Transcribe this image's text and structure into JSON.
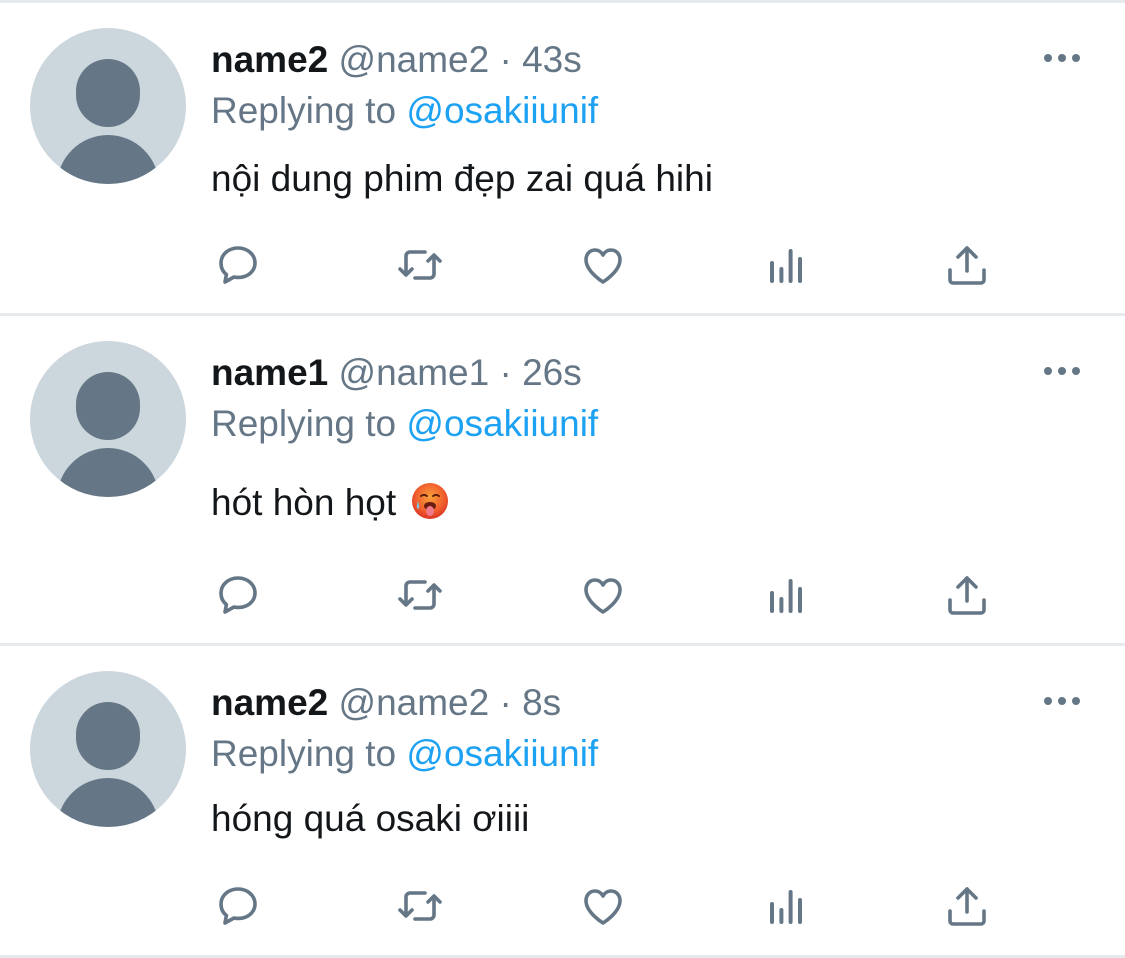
{
  "tweets": [
    {
      "display_name": "name2",
      "handle": "@name2",
      "separator": "·",
      "time": "43s",
      "replying_prefix": "Replying to",
      "replying_handle": "@osakiiunif",
      "text": "nội dung phim đẹp zai quá hihi"
    },
    {
      "display_name": "name1",
      "handle": "@name1",
      "separator": "·",
      "time": "26s",
      "replying_prefix": "Replying to",
      "replying_handle": "@osakiiunif",
      "text": "hót hòn họt",
      "emoji": "hot-face-emoji"
    },
    {
      "display_name": "name2",
      "handle": "@name2",
      "separator": "·",
      "time": "8s",
      "replying_prefix": "Replying to",
      "replying_handle": "@osakiiunif",
      "text": "hóng quá osaki ơiiii"
    }
  ],
  "icons": {
    "reply": "reply-icon",
    "retweet": "retweet-icon",
    "like": "heart-icon",
    "analytics": "analytics-icon",
    "share": "share-icon",
    "more": "more-icon"
  },
  "colors": {
    "text_primary": "#14171a",
    "text_secondary": "#657786",
    "mention": "#1da1f2",
    "avatar_bg": "#ccd6dd",
    "divider": "#e7eaed"
  }
}
